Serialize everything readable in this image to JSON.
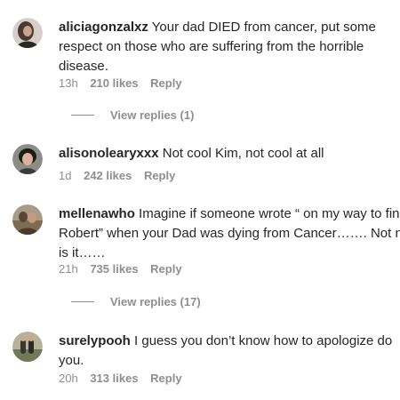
{
  "comments": [
    {
      "username": "aliciagonzalxz",
      "lines": [
        "Your dad DIED from cancer, put some",
        "respect on those who are suffering from the horrible",
        "disease."
      ],
      "time": "13h",
      "likes": "210 likes",
      "reply_label": "Reply",
      "view_replies": "View replies (1)",
      "avatar_icon": "user-avatar-icon"
    },
    {
      "username": "alisonolearyxxx",
      "lines": [
        "Not cool Kim, not cool at all"
      ],
      "time": "1d",
      "likes": "242 likes",
      "reply_label": "Reply",
      "avatar_icon": "user-avatar-icon"
    },
    {
      "username": "mellenawho",
      "lines": [
        "Imagine if someone wrote “ on my way to fin",
        "Robert” when your Dad was dying from Cancer……. Not ni",
        "is it……"
      ],
      "time": "21h",
      "likes": "735 likes",
      "reply_label": "Reply",
      "view_replies": "View replies (17)",
      "avatar_icon": "user-avatar-icon"
    },
    {
      "username": "surelypooh",
      "lines": [
        "I guess you don’t know how to apologize do",
        "you."
      ],
      "time": "20h",
      "likes": "313 likes",
      "reply_label": "Reply",
      "avatar_icon": "user-avatar-icon"
    }
  ],
  "colors": {
    "text": "#262626",
    "secondary": "#8e8e8e",
    "background": "#ffffff"
  }
}
